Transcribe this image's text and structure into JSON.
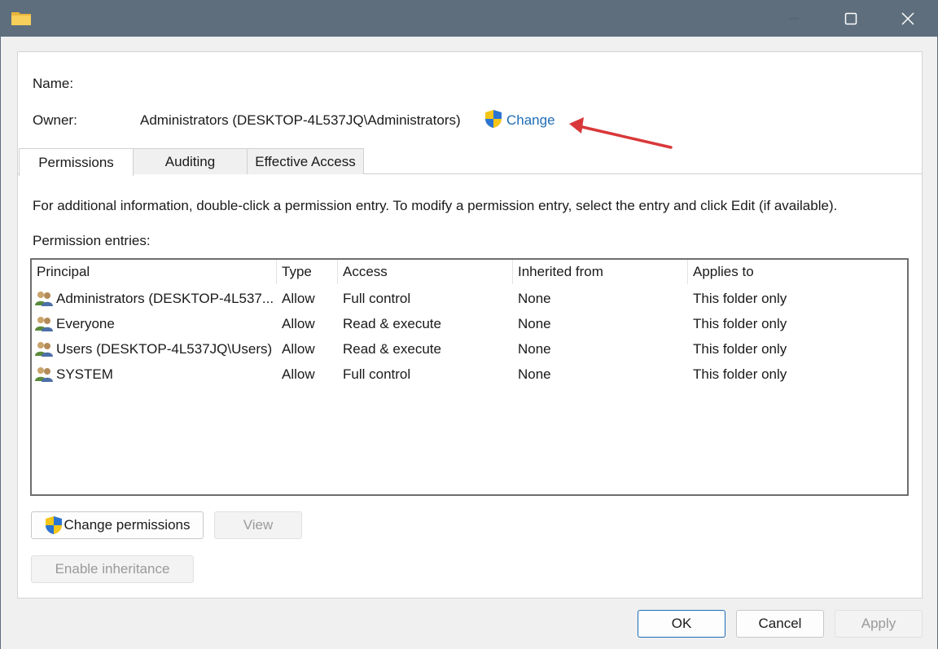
{
  "window": {
    "title": "",
    "colors": {
      "titlebar": "#5e6e7c",
      "accent": "#1e6cb4"
    }
  },
  "header": {
    "name_label": "Name:",
    "owner_label": "Owner:",
    "owner_value": "Administrators (DESKTOP-4L537JQ\\Administrators)",
    "change_link": "Change"
  },
  "tabs": [
    {
      "label": "Permissions",
      "selected": true
    },
    {
      "label": "Auditing",
      "selected": false
    },
    {
      "label": "Effective Access",
      "selected": false
    }
  ],
  "info_text": "For additional information, double-click a permission entry. To modify a permission entry, select the entry and click Edit (if available).",
  "entries_label": "Permission entries:",
  "table": {
    "columns": [
      "Principal",
      "Type",
      "Access",
      "Inherited from",
      "Applies to"
    ],
    "rows": [
      {
        "principal": "Administrators (DESKTOP-4L537...",
        "type": "Allow",
        "access": "Full control",
        "inherited": "None",
        "applies": "This folder only"
      },
      {
        "principal": "Everyone",
        "type": "Allow",
        "access": "Read & execute",
        "inherited": "None",
        "applies": "This folder only"
      },
      {
        "principal": "Users (DESKTOP-4L537JQ\\Users)",
        "type": "Allow",
        "access": "Read & execute",
        "inherited": "None",
        "applies": "This folder only"
      },
      {
        "principal": "SYSTEM",
        "type": "Allow",
        "access": "Full control",
        "inherited": "None",
        "applies": "This folder only"
      }
    ]
  },
  "buttons": {
    "change_permissions": "Change permissions",
    "view": "View",
    "enable_inheritance": "Enable inheritance",
    "ok": "OK",
    "cancel": "Cancel",
    "apply": "Apply"
  },
  "icons": {
    "folder": "folder-icon",
    "shield": "uac-shield-icon",
    "user": "user-group-icon"
  }
}
